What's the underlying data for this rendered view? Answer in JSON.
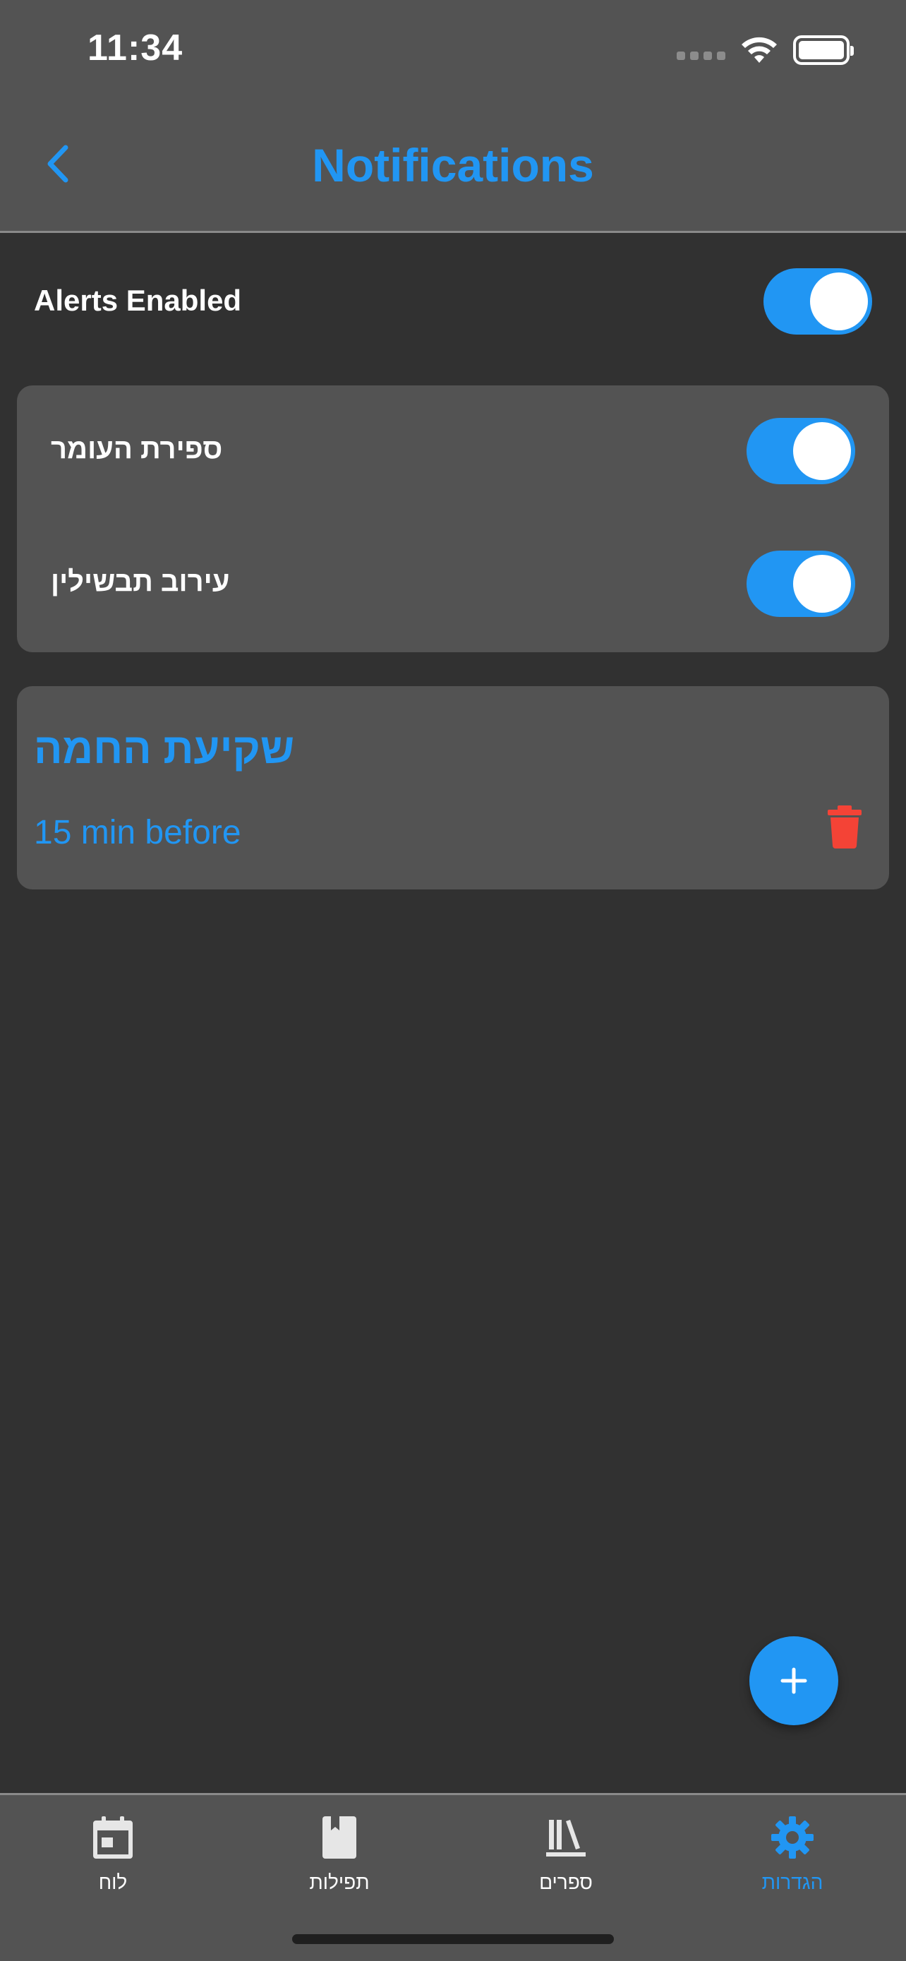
{
  "status_bar": {
    "time": "11:34"
  },
  "header": {
    "title": "Notifications",
    "back_icon": "chevron-left-icon"
  },
  "alerts": {
    "label": "Alerts Enabled",
    "enabled": true
  },
  "toggles": [
    {
      "label": "ספירת העומר",
      "enabled": true
    },
    {
      "label": "עירוב תבשילין",
      "enabled": true
    }
  ],
  "event": {
    "title": "שקיעת החמה",
    "subtitle": "15 min before",
    "delete_icon": "trash-icon"
  },
  "fab": {
    "icon": "plus-icon"
  },
  "tabs": [
    {
      "label": "לוח",
      "icon": "calendar-icon",
      "active": false
    },
    {
      "label": "תפילות",
      "icon": "book-icon",
      "active": false
    },
    {
      "label": "ספרים",
      "icon": "library-icon",
      "active": false
    },
    {
      "label": "הגדרות",
      "icon": "gear-icon",
      "active": true
    }
  ],
  "colors": {
    "accent": "#2196f3",
    "background": "#313131",
    "surface": "#535353",
    "danger": "#f44336"
  }
}
